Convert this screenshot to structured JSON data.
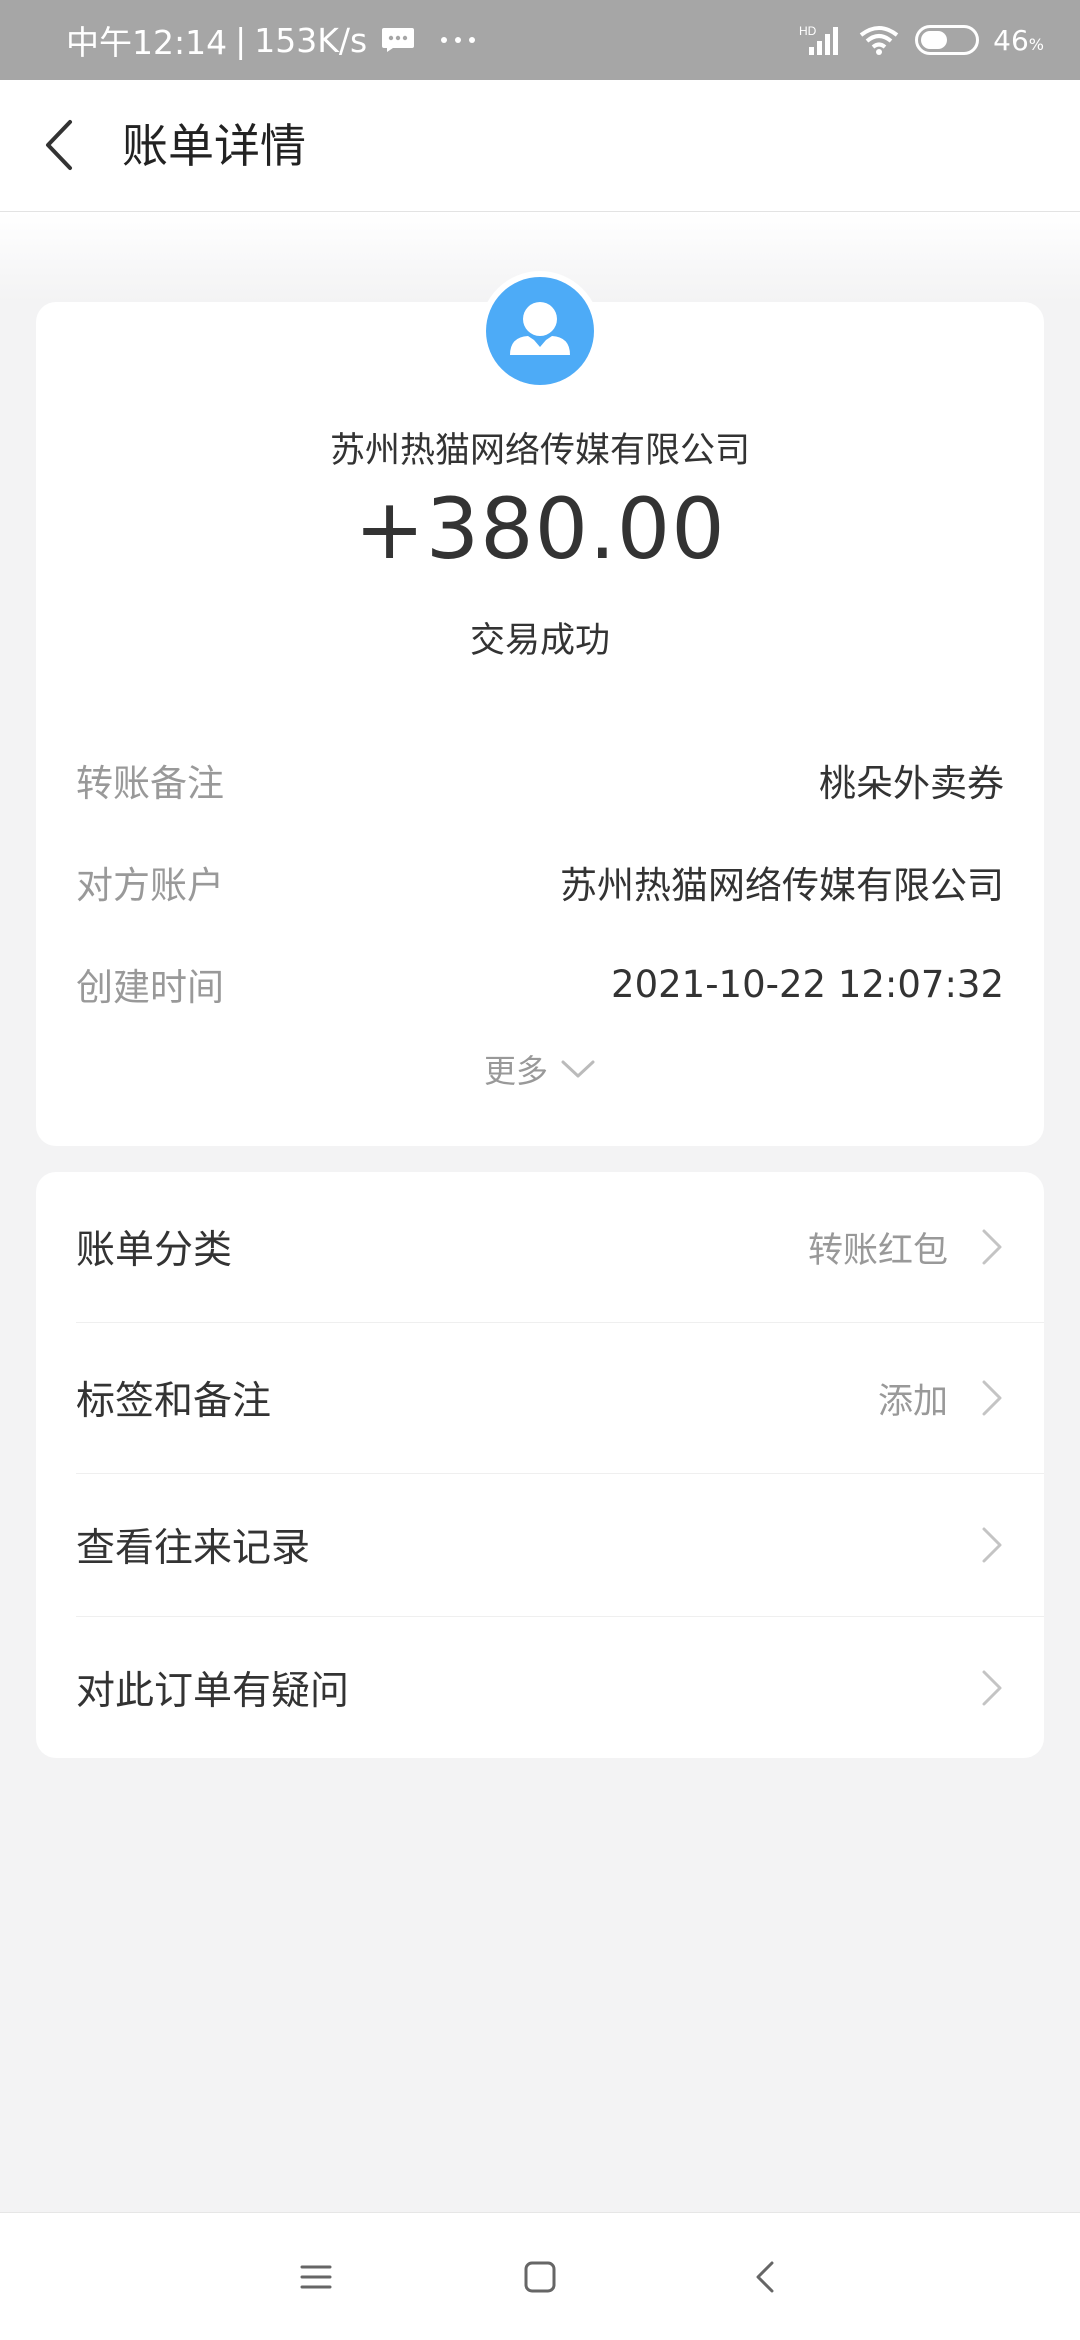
{
  "status_bar": {
    "time": "中午12:14",
    "separator": "|",
    "speed": "153K/s",
    "network": "HD",
    "battery_level": "46",
    "battery_unit": "%",
    "icons": [
      "message-icon",
      "more-dots-icon",
      "signal-icon",
      "wifi-icon",
      "battery-icon"
    ]
  },
  "header": {
    "title": "账单详情",
    "back_icon": "chevron-left-icon"
  },
  "transaction": {
    "payee": "苏州热猫网络传媒有限公司",
    "amount": "+380.00",
    "status": "交易成功",
    "avatar_color": "#4dabf7",
    "details": [
      {
        "label": "转账备注",
        "value": "桃朵外卖券"
      },
      {
        "label": "对方账户",
        "value": "苏州热猫网络传媒有限公司"
      },
      {
        "label": "创建时间",
        "value": "2021-10-22 12:07:32"
      }
    ],
    "more_label": "更多"
  },
  "menu": {
    "items": [
      {
        "label": "账单分类",
        "value": "转账红包"
      },
      {
        "label": "标签和备注",
        "value": "添加"
      },
      {
        "label": "查看往来记录",
        "value": ""
      },
      {
        "label": "对此订单有疑问",
        "value": ""
      }
    ]
  },
  "nav": {
    "buttons": [
      "menu-icon",
      "home-icon",
      "back-icon"
    ]
  },
  "colors": {
    "status_bar_bg": "#a6a6a6",
    "page_bg": "#f3f3f4",
    "card_bg": "#ffffff",
    "primary_text": "#333333",
    "secondary_text": "#999999",
    "avatar_blue": "#4dabf7"
  }
}
